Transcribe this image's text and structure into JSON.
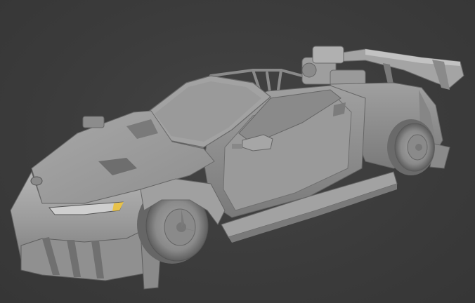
{
  "scene": {
    "subject": "",
    "background_color": "#3a3a3a",
    "model_color": "#9a9a9a",
    "highlight_color": "#c8c8c8",
    "shadow_color": "#6e6e6e",
    "headlight_accent": "#e8c24a"
  }
}
